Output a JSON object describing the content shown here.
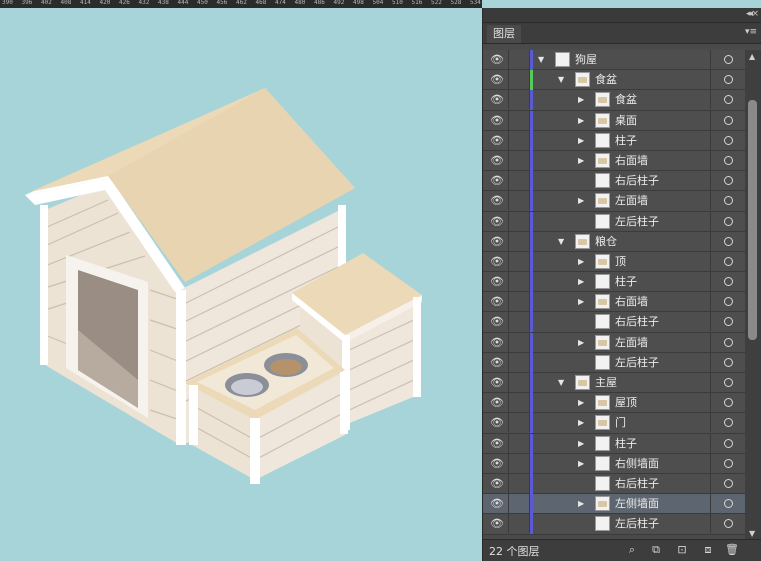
{
  "ruler": {
    "labels": [
      "390",
      "396",
      "402",
      "408",
      "414",
      "420",
      "426",
      "432",
      "438",
      "444",
      "450",
      "456",
      "462",
      "468",
      "474",
      "480",
      "486",
      "492",
      "498",
      "504",
      "510",
      "516",
      "522",
      "528",
      "534"
    ]
  },
  "canvas": {
    "background": "#a6d4d8",
    "artwork": "isometric dog house with food bowls and storage bin"
  },
  "panel": {
    "tab_label": "图层",
    "layer_count": "22 个图层",
    "layers": [
      {
        "name": "狗屋",
        "level": 0,
        "expanded": true,
        "arrow": true,
        "thumb": "blank",
        "selected": false,
        "barcolor": "#5a5ad6"
      },
      {
        "name": "食盆",
        "level": 1,
        "expanded": true,
        "arrow": true,
        "thumb": "art",
        "selected": false,
        "barcolor": "#57c95c"
      },
      {
        "name": "食盆",
        "level": 2,
        "expanded": false,
        "arrow": true,
        "thumb": "art",
        "selected": false,
        "barcolor": "#5a5ad6"
      },
      {
        "name": "桌面",
        "level": 2,
        "expanded": false,
        "arrow": true,
        "thumb": "art",
        "selected": false,
        "barcolor": "#5a5ad6"
      },
      {
        "name": "柱子",
        "level": 2,
        "expanded": false,
        "arrow": true,
        "thumb": "blank",
        "selected": false,
        "barcolor": "#5a5ad6"
      },
      {
        "name": "右面墙",
        "level": 2,
        "expanded": false,
        "arrow": true,
        "thumb": "art",
        "selected": false,
        "barcolor": "#5a5ad6"
      },
      {
        "name": "右后柱子",
        "level": 2,
        "expanded": false,
        "arrow": false,
        "thumb": "blank",
        "selected": false,
        "barcolor": "#5a5ad6"
      },
      {
        "name": "左面墙",
        "level": 2,
        "expanded": false,
        "arrow": true,
        "thumb": "art",
        "selected": false,
        "barcolor": "#5a5ad6"
      },
      {
        "name": "左后柱子",
        "level": 2,
        "expanded": false,
        "arrow": false,
        "thumb": "blank",
        "selected": false,
        "barcolor": "#5a5ad6"
      },
      {
        "name": "粮仓",
        "level": 1,
        "expanded": true,
        "arrow": true,
        "thumb": "art",
        "selected": false,
        "barcolor": "#5a5ad6"
      },
      {
        "name": "顶",
        "level": 2,
        "expanded": false,
        "arrow": true,
        "thumb": "art",
        "selected": false,
        "barcolor": "#5a5ad6"
      },
      {
        "name": "柱子",
        "level": 2,
        "expanded": false,
        "arrow": true,
        "thumb": "blank",
        "selected": false,
        "barcolor": "#5a5ad6"
      },
      {
        "name": "右面墙",
        "level": 2,
        "expanded": false,
        "arrow": true,
        "thumb": "art",
        "selected": false,
        "barcolor": "#5a5ad6"
      },
      {
        "name": "右后柱子",
        "level": 2,
        "expanded": false,
        "arrow": false,
        "thumb": "blank",
        "selected": false,
        "barcolor": "#5a5ad6"
      },
      {
        "name": "左面墙",
        "level": 2,
        "expanded": false,
        "arrow": true,
        "thumb": "art",
        "selected": false,
        "barcolor": "#5a5ad6"
      },
      {
        "name": "左后柱子",
        "level": 2,
        "expanded": false,
        "arrow": false,
        "thumb": "blank",
        "selected": false,
        "barcolor": "#5a5ad6"
      },
      {
        "name": "主屋",
        "level": 1,
        "expanded": true,
        "arrow": true,
        "thumb": "art",
        "selected": false,
        "barcolor": "#5a5ad6"
      },
      {
        "name": "屋顶",
        "level": 2,
        "expanded": false,
        "arrow": true,
        "thumb": "art",
        "selected": false,
        "barcolor": "#5a5ad6"
      },
      {
        "name": "门",
        "level": 2,
        "expanded": false,
        "arrow": true,
        "thumb": "art",
        "selected": false,
        "barcolor": "#5a5ad6"
      },
      {
        "name": "柱子",
        "level": 2,
        "expanded": false,
        "arrow": true,
        "thumb": "blank",
        "selected": false,
        "barcolor": "#5a5ad6"
      },
      {
        "name": "右侧墙面",
        "level": 2,
        "expanded": false,
        "arrow": true,
        "thumb": "blank",
        "selected": false,
        "barcolor": "#5a5ad6"
      },
      {
        "name": "右后柱子",
        "level": 2,
        "expanded": false,
        "arrow": false,
        "thumb": "blank",
        "selected": false,
        "barcolor": "#5a5ad6"
      },
      {
        "name": "左侧墙面",
        "level": 2,
        "expanded": false,
        "arrow": true,
        "thumb": "art",
        "selected": true,
        "barcolor": "#5a5ad6"
      },
      {
        "name": "左后柱子",
        "level": 2,
        "expanded": false,
        "arrow": false,
        "thumb": "blank",
        "selected": false,
        "barcolor": "#5a5ad6"
      }
    ],
    "footer_icons": [
      "search-icon",
      "locate-object-icon",
      "make-clipping-mask-icon",
      "new-sublayer-icon",
      "new-layer-icon",
      "delete-icon"
    ]
  }
}
